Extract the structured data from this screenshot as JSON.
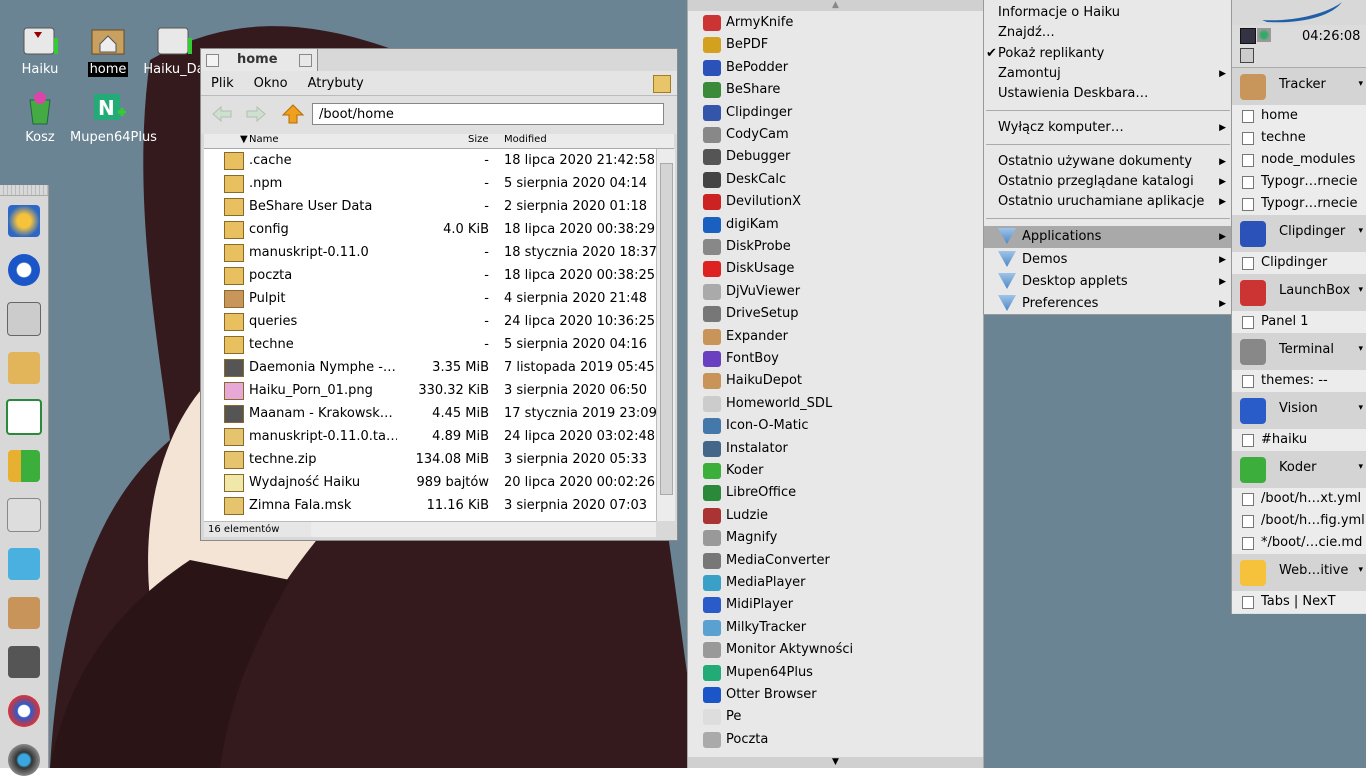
{
  "desktop": {
    "icons": [
      {
        "label": "Haiku",
        "icon": "disk-icon"
      },
      {
        "label": "home",
        "icon": "home-folder-icon",
        "selected": true
      },
      {
        "label": "Haiku_Da",
        "icon": "disk-icon"
      },
      {
        "label": "Kosz",
        "icon": "trash-icon"
      },
      {
        "label": "Mupen64Plus",
        "icon": "n64-icon"
      }
    ]
  },
  "launchbar": {
    "items": [
      "webpositive-icon",
      "otter-browser-icon",
      "tracker-icon",
      "folder-icon",
      "libreoffice-icon",
      "koder-icon",
      "beshare-icon",
      "medo-icon",
      "expander-icon",
      "deskcalc-icon",
      "vision-icon",
      "digikam-icon"
    ]
  },
  "tracker": {
    "title": "home",
    "menu": [
      "Plik",
      "Okno",
      "Atrybuty"
    ],
    "path": "/boot/home",
    "columns": {
      "name": "Name",
      "size": "Size",
      "modified": "Modified"
    },
    "rows": [
      {
        "name": ".cache",
        "size": "-",
        "modified": "18 lipca 2020 21:42:58",
        "kind": "folder"
      },
      {
        "name": ".npm",
        "size": "-",
        "modified": "5 sierpnia 2020 04:14",
        "kind": "folder"
      },
      {
        "name": "BeShare User Data",
        "size": "-",
        "modified": "2 sierpnia 2020 01:18",
        "kind": "folder"
      },
      {
        "name": "config",
        "size": "4.0 KiB",
        "modified": "18 lipca 2020 00:38:29",
        "kind": "folder-link"
      },
      {
        "name": "manuskript-0.11.0",
        "size": "-",
        "modified": "18 stycznia 2020 18:37",
        "kind": "folder"
      },
      {
        "name": "poczta",
        "size": "-",
        "modified": "18 lipca 2020 00:38:25",
        "kind": "folder"
      },
      {
        "name": "Pulpit",
        "size": "-",
        "modified": "4 sierpnia 2020 21:48",
        "kind": "package"
      },
      {
        "name": "queries",
        "size": "-",
        "modified": "24 lipca 2020 10:36:25",
        "kind": "folder"
      },
      {
        "name": "techne",
        "size": "-",
        "modified": "5 sierpnia 2020 04:16",
        "kind": "folder"
      },
      {
        "name": "Daemonia Nymphe -…",
        "size": "3.35 MiB",
        "modified": "7 listopada 2019 05:45",
        "kind": "audio"
      },
      {
        "name": "Haiku_Porn_01.png",
        "size": "330.32 KiB",
        "modified": "3 sierpnia 2020 06:50",
        "kind": "image"
      },
      {
        "name": "Maanam - Krakowsk…",
        "size": "4.45 MiB",
        "modified": "17 stycznia 2019 23:09",
        "kind": "audio"
      },
      {
        "name": "manuskript-0.11.0.ta…",
        "size": "4.89 MiB",
        "modified": "24 lipca 2020 03:02:48",
        "kind": "archive"
      },
      {
        "name": "techne.zip",
        "size": "134.08 MiB",
        "modified": "3 sierpnia 2020 05:33",
        "kind": "archive"
      },
      {
        "name": "Wydajność Haiku",
        "size": "989 bajtów",
        "modified": "20 lipca 2020 00:02:26",
        "kind": "document"
      },
      {
        "name": "Zimna Fala.msk",
        "size": "11.16 KiB",
        "modified": "3 sierpnia 2020 07:03",
        "kind": "archive"
      }
    ],
    "status": "16 elementów"
  },
  "applications": [
    "ArmyKnife",
    "BePDF",
    "BePodder",
    "BeShare",
    "Clipdinger",
    "CodyCam",
    "Debugger",
    "DeskCalc",
    "DevilutionX",
    "digiKam",
    "DiskProbe",
    "DiskUsage",
    "DjVuViewer",
    "DriveSetup",
    "Expander",
    "FontBoy",
    "HaikuDepot",
    "Homeworld_SDL",
    "Icon-O-Matic",
    "Instalator",
    "Koder",
    "LibreOffice",
    "Ludzie",
    "Magnify",
    "MediaConverter",
    "MediaPlayer",
    "MidiPlayer",
    "MilkyTracker",
    "Monitor Aktywności",
    "Mupen64Plus",
    "Otter Browser",
    "Pe",
    "Poczta"
  ],
  "deskbar_menu": {
    "top": [
      "Informacje o Haiku",
      "Znajdź…",
      "Pokaż replikanty",
      "Zamontuj",
      "Ustawienia Deskbara…"
    ],
    "power": "Wyłącz komputer…",
    "recent": [
      "Ostatnio używane dokumenty",
      "Ostatnio przeglądane katalogi",
      "Ostatnio uruchamiane aplikacje"
    ],
    "folders": [
      "Applications",
      "Demos",
      "Desktop applets",
      "Preferences"
    ],
    "highlighted": "Applications"
  },
  "deskbar": {
    "clock": "04:26:08",
    "apps": [
      {
        "name": "Tracker",
        "windows": [
          "home",
          "techne",
          "node_modules",
          "Typogr…rnecie",
          "Typogr…rnecie"
        ]
      },
      {
        "name": "Clipdinger",
        "windows": [
          "Clipdinger"
        ]
      },
      {
        "name": "LaunchBox",
        "windows": [
          "Panel 1"
        ]
      },
      {
        "name": "Terminal",
        "windows": [
          "themes: --"
        ]
      },
      {
        "name": "Vision",
        "windows": [
          "#haiku"
        ]
      },
      {
        "name": "Koder",
        "windows": [
          "/boot/h…xt.yml",
          "/boot/h…fig.yml",
          "*/boot/…cie.md"
        ]
      },
      {
        "name": "Web…itive",
        "windows": [
          "Tabs | NexT"
        ]
      }
    ]
  }
}
